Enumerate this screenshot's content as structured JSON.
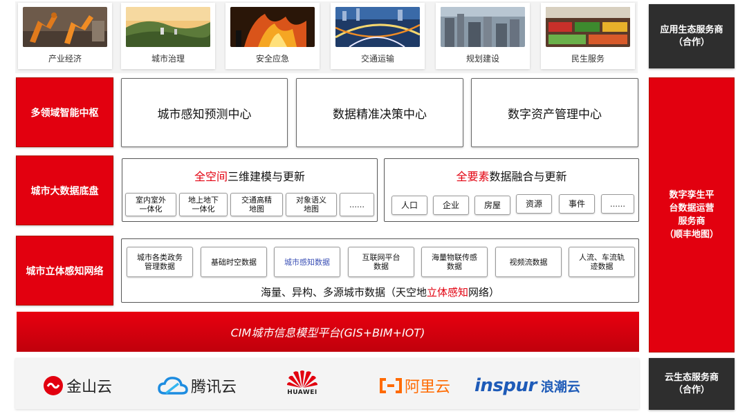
{
  "scenarios": [
    {
      "label": "产业经济"
    },
    {
      "label": "城市治理"
    },
    {
      "label": "安全应急"
    },
    {
      "label": "交通运输"
    },
    {
      "label": "规划建设"
    },
    {
      "label": "民生服务"
    }
  ],
  "layers": {
    "hub": "多领域智能中枢",
    "bigdata": "城市大数据底盘",
    "sensing": "城市立体感知网络"
  },
  "centers": [
    "城市感知预测中心",
    "数据精准决策中心",
    "数字资产管理中心"
  ],
  "modeling": {
    "title_highlight": "全空间",
    "title_rest": "三维建模与更新",
    "chips": [
      "室内室外\n一体化",
      "地上地下\n一体化",
      "交通高精\n地图",
      "对象语义\n地图",
      "……"
    ]
  },
  "fusion": {
    "title_highlight": "全要素",
    "title_rest": "数据融合与更新",
    "chips": [
      "人口",
      "企业",
      "房屋",
      "资源",
      "事件",
      "……"
    ]
  },
  "sensing_panel": {
    "chips": [
      "城市各类政务\n管理数据",
      "基础时空数据",
      "城市感知数据",
      "互联网平台\n数据",
      "海量物联传感\n数据",
      "视频流数据",
      "人流、车流轨\n迹数据"
    ],
    "footer_pre": "海量、异构、多源城市数据（天空地",
    "footer_highlight": "立体感知",
    "footer_post": "网络）"
  },
  "cim_platform": "CIM城市信息模型平台(GIS+BIM+IOT)",
  "cloud_logos": {
    "kingsoft": "金山云",
    "tencent": "腾讯云",
    "huawei": "HUAWEI",
    "aliyun": "阿里云",
    "inspur_en": "inspur",
    "inspur_cn": "浪潮云"
  },
  "right_side": {
    "app_ecosystem": "应用生态服务商\n（合作）",
    "twin_platform": "数字孪生平\n台数据运营\n服务商\n（顺丰地图）",
    "cloud_ecosystem": "云生态服务商\n（合作）"
  },
  "colors": {
    "accent_red": "#e2000f",
    "dark": "#2e2e2e",
    "blue_text": "#3a4fb5"
  }
}
